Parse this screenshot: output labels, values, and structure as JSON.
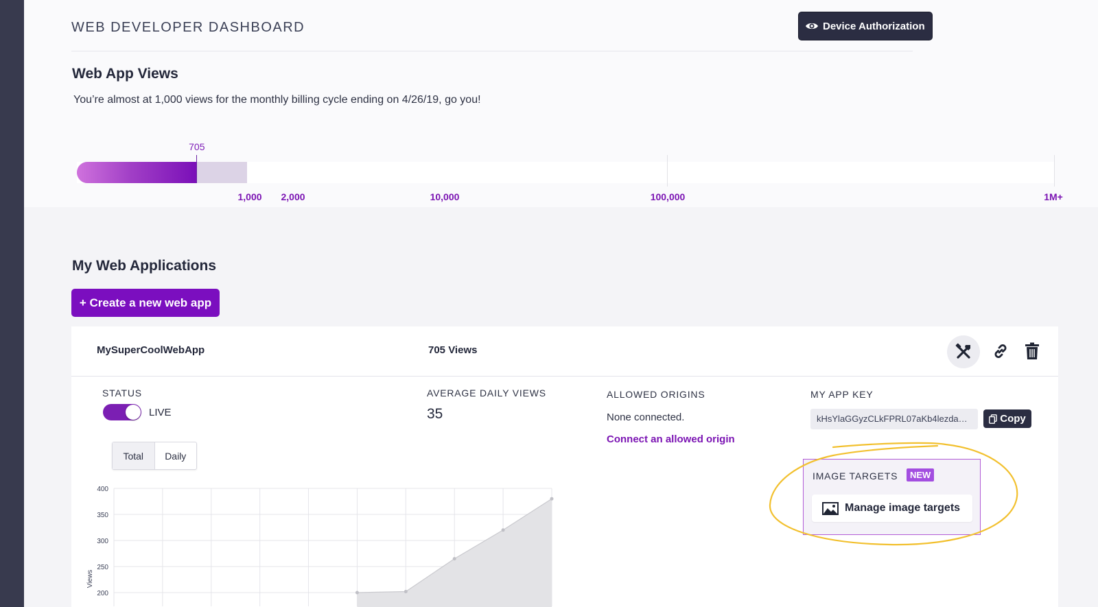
{
  "header": {
    "title": "WEB DEVELOPER DASHBOARD",
    "device_auth_label": "Device Authorization"
  },
  "views": {
    "title": "Web App Views",
    "description": "You’re almost at 1,000 views for the monthly billing cycle ending on 4/26/19, go you!",
    "current": 705,
    "current_label": "705",
    "ticks": [
      "1,000",
      "2,000",
      "10,000",
      "100,000",
      "1M+"
    ]
  },
  "apps": {
    "title": "My Web Applications",
    "create_label": "+ Create a new web app",
    "app": {
      "name": "MySuperCoolWebApp",
      "views_label": "705 Views",
      "status_label": "STATUS",
      "status_value": "LIVE",
      "status_on": true,
      "avg_label": "AVERAGE DAILY VIEWS",
      "avg_value": "35",
      "origins_label": "ALLOWED ORIGINS",
      "origins_value": "None connected.",
      "connect_label": "Connect an allowed origin",
      "key_label": "MY APP KEY",
      "key_value": "kHsYlaGGyzCLkFPRL07aKb4lezda…",
      "copy_label": "Copy",
      "image_targets_label": "IMAGE TARGETS",
      "new_badge": "NEW",
      "manage_label": "Manage image targets",
      "tabs": [
        "Total",
        "Daily"
      ],
      "active_tab": "Total"
    }
  },
  "chart_data": {
    "type": "area",
    "ylabel": "Views",
    "ylim": [
      200,
      400
    ],
    "y_ticks": [
      "400",
      "350",
      "300",
      "250",
      "200"
    ],
    "x": [
      0,
      1,
      2,
      3,
      4,
      5,
      6,
      7,
      8,
      9
    ],
    "values": [
      null,
      null,
      null,
      null,
      null,
      200,
      202,
      265,
      320,
      380
    ],
    "grid": true
  },
  "colors": {
    "accent": "#7b0ebf",
    "dark_button": "#2b2d42",
    "sidebar": "#383a4e",
    "annotation": "#f2c02e"
  },
  "icons": {
    "device_auth": "eye-icon",
    "tools": "tools-icon",
    "link": "link-icon",
    "trash": "trash-icon",
    "copy": "copy-icon",
    "image": "image-icon"
  }
}
